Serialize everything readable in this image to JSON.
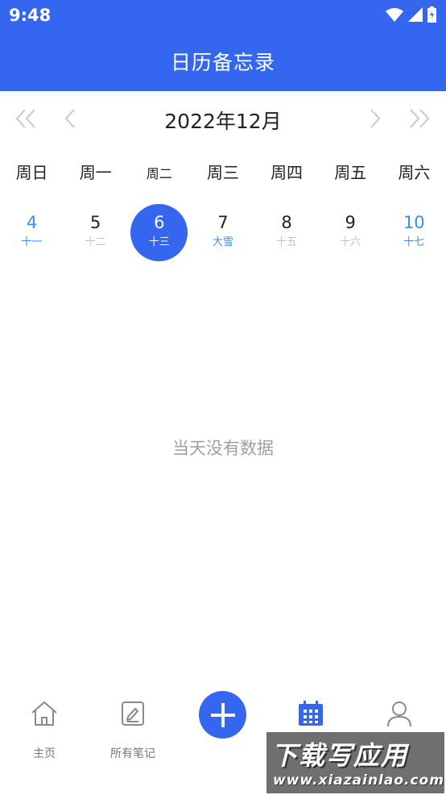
{
  "status_bar": {
    "time": "9:48"
  },
  "app_bar": {
    "title": "日历备忘录"
  },
  "calendar": {
    "month_label": "2022年12月",
    "weekdays": [
      "周日",
      "周一",
      "周二",
      "周三",
      "周四",
      "周五",
      "周六"
    ],
    "days": [
      {
        "day": "4",
        "lunar": "十一"
      },
      {
        "day": "5",
        "lunar": "十二"
      },
      {
        "day": "6",
        "lunar": "十三",
        "selected": true
      },
      {
        "day": "7",
        "lunar": "大雪"
      },
      {
        "day": "8",
        "lunar": "十五"
      },
      {
        "day": "9",
        "lunar": "十六"
      },
      {
        "day": "10",
        "lunar": "十七"
      }
    ]
  },
  "empty_state": {
    "text": "当天没有数据"
  },
  "tab_bar": {
    "items": [
      {
        "label": "主页",
        "icon": "home-icon"
      },
      {
        "label": "所有笔记",
        "icon": "notes-icon"
      },
      {
        "label": "",
        "icon": "plus-icon"
      },
      {
        "label": "",
        "icon": "calendar-icon",
        "active": true
      },
      {
        "label": "",
        "icon": "person-icon"
      }
    ]
  },
  "watermark": {
    "line1": "下载写应用",
    "line2": "www.xiazainlao.com"
  },
  "colors": {
    "primary": "#3466f0",
    "weekend": "#3d8ef2",
    "muted": "#c4c4c4",
    "empty_text": "#a0a0a0"
  }
}
